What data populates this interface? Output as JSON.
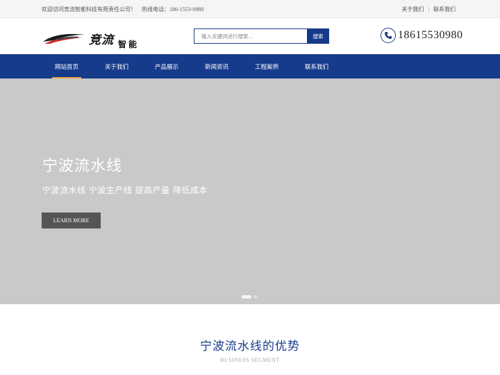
{
  "topbar": {
    "welcome": "欢迎访问竞流智能科技有限责任公司！",
    "hotline": "热线电话：186-1553-0980",
    "links": [
      "关于我们",
      "联系我们"
    ]
  },
  "header": {
    "logo": {
      "brand_main": "竞流",
      "brand_sub": "智能"
    },
    "search": {
      "placeholder": "输入关键词进行搜索...",
      "button_label": "搜索"
    },
    "phone": "18615530980"
  },
  "nav": {
    "items": [
      {
        "label": "网站首页",
        "active": true
      },
      {
        "label": "关于我们",
        "active": false
      },
      {
        "label": "产品展示",
        "active": false
      },
      {
        "label": "新闻资讯",
        "active": false
      },
      {
        "label": "工程案例",
        "active": false
      },
      {
        "label": "联系我们",
        "active": false
      }
    ]
  },
  "banner": {
    "title": "宁波流水线",
    "subtitle": "宁波流水线 宁波生产线 提高产量 降低成本",
    "button_label": "LEARN MORE",
    "slides_count": 2,
    "active_slide": 0
  },
  "section": {
    "heading": "宁波流水线的优势",
    "subheading": "BUSINESS SEGMENT"
  },
  "colors": {
    "primary": "#173b8b",
    "accent": "#e8a640",
    "banner_bg": "#c9c9c9"
  }
}
